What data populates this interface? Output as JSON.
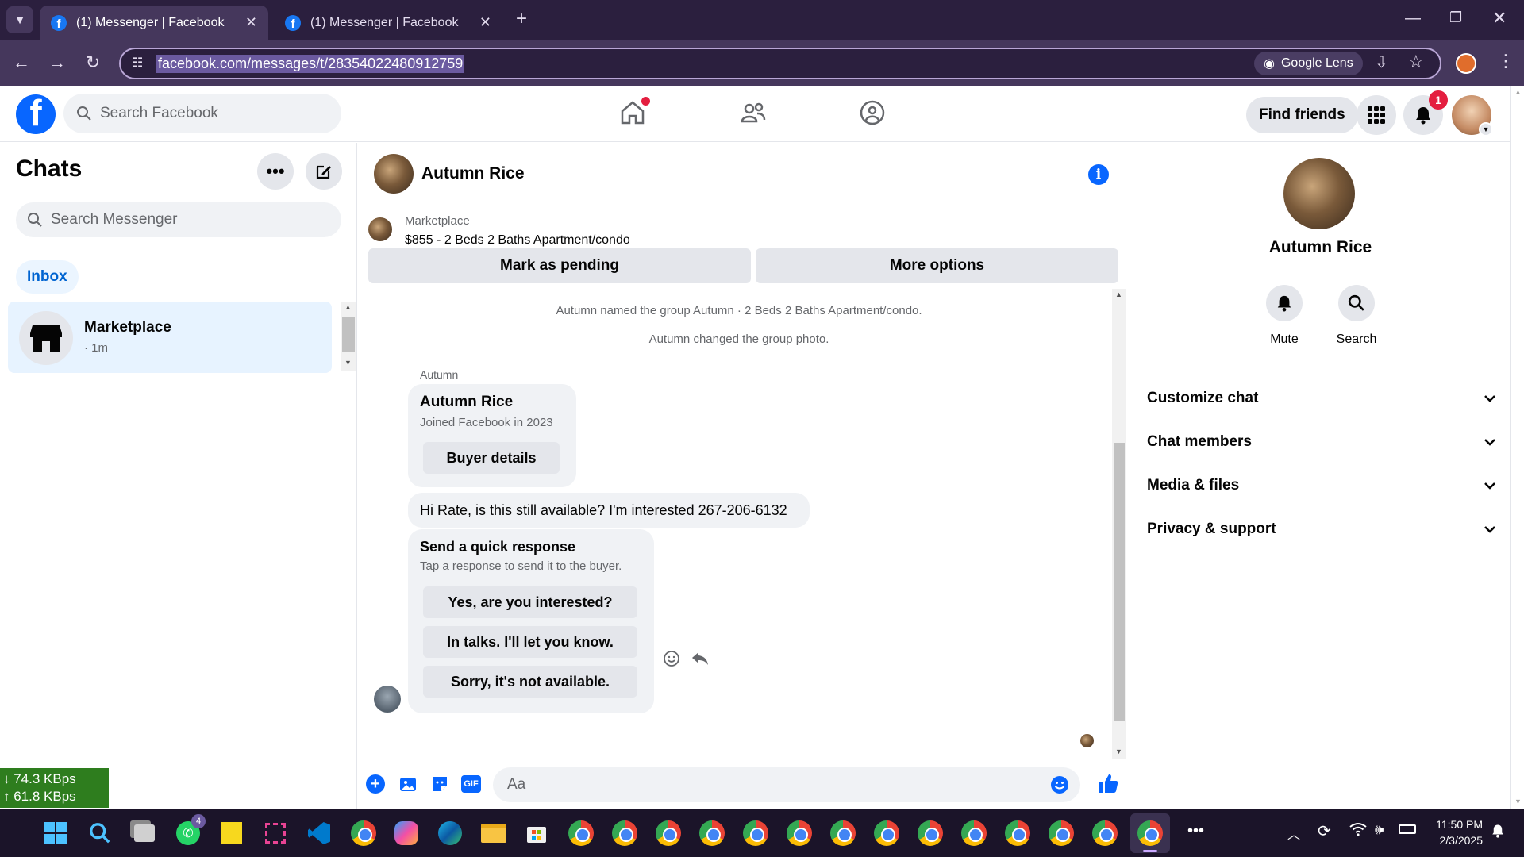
{
  "browser": {
    "tabs": [
      {
        "title": "(1) Messenger | Facebook",
        "active": true
      },
      {
        "title": "(1) Messenger | Facebook",
        "active": false
      }
    ],
    "url": "facebook.com/messages/t/28354022480912759",
    "google_lens": "Google Lens"
  },
  "fb_header": {
    "logo": "f",
    "search_placeholder": "Search Facebook",
    "find_friends": "Find friends",
    "notification_count": "1"
  },
  "left": {
    "title": "Chats",
    "search_placeholder": "Search Messenger",
    "filter_inbox": "Inbox",
    "threads": [
      {
        "name": "Marketplace",
        "meta": "· 1m"
      }
    ]
  },
  "conversation": {
    "contact_name": "Autumn Rice",
    "listing_source": "Marketplace",
    "listing_title": "$855 - 2 Beds 2 Baths Apartment/condo",
    "mark_pending": "Mark as pending",
    "more_options": "More options",
    "system_messages": [
      "Autumn named the group Autumn · 2 Beds 2 Baths Apartment/condo.",
      "Autumn changed the group photo."
    ],
    "sender_label": "Autumn",
    "profile_card": {
      "name": "Autumn Rice",
      "joined": "Joined Facebook in 2023",
      "button": "Buyer details"
    },
    "message": "Hi Rate, is this still available? I'm interested 267-206-6132",
    "quick_response": {
      "title": "Send a quick response",
      "subtitle": "Tap a response to send it to the buyer.",
      "options": [
        "Yes, are you interested?",
        "In talks. I'll let you know.",
        "Sorry, it's not available."
      ]
    },
    "composer_placeholder": "Aa"
  },
  "right": {
    "name": "Autumn Rice",
    "actions": [
      {
        "label": "Mute",
        "icon": "bell-icon"
      },
      {
        "label": "Search",
        "icon": "search-icon"
      }
    ],
    "sections": [
      "Customize chat",
      "Chat members",
      "Media & files",
      "Privacy & support"
    ]
  },
  "netspeed": {
    "down": "↓ 74.3 KBps",
    "up": "↑ 61.8 KBps"
  },
  "taskbar": {
    "whatsapp_badge": "4",
    "time": "11:50 PM",
    "date": "2/3/2025"
  },
  "colors": {
    "accent": "#0866ff",
    "chrome_tab": "#45375c",
    "chrome_bar": "#2b1f3e"
  }
}
